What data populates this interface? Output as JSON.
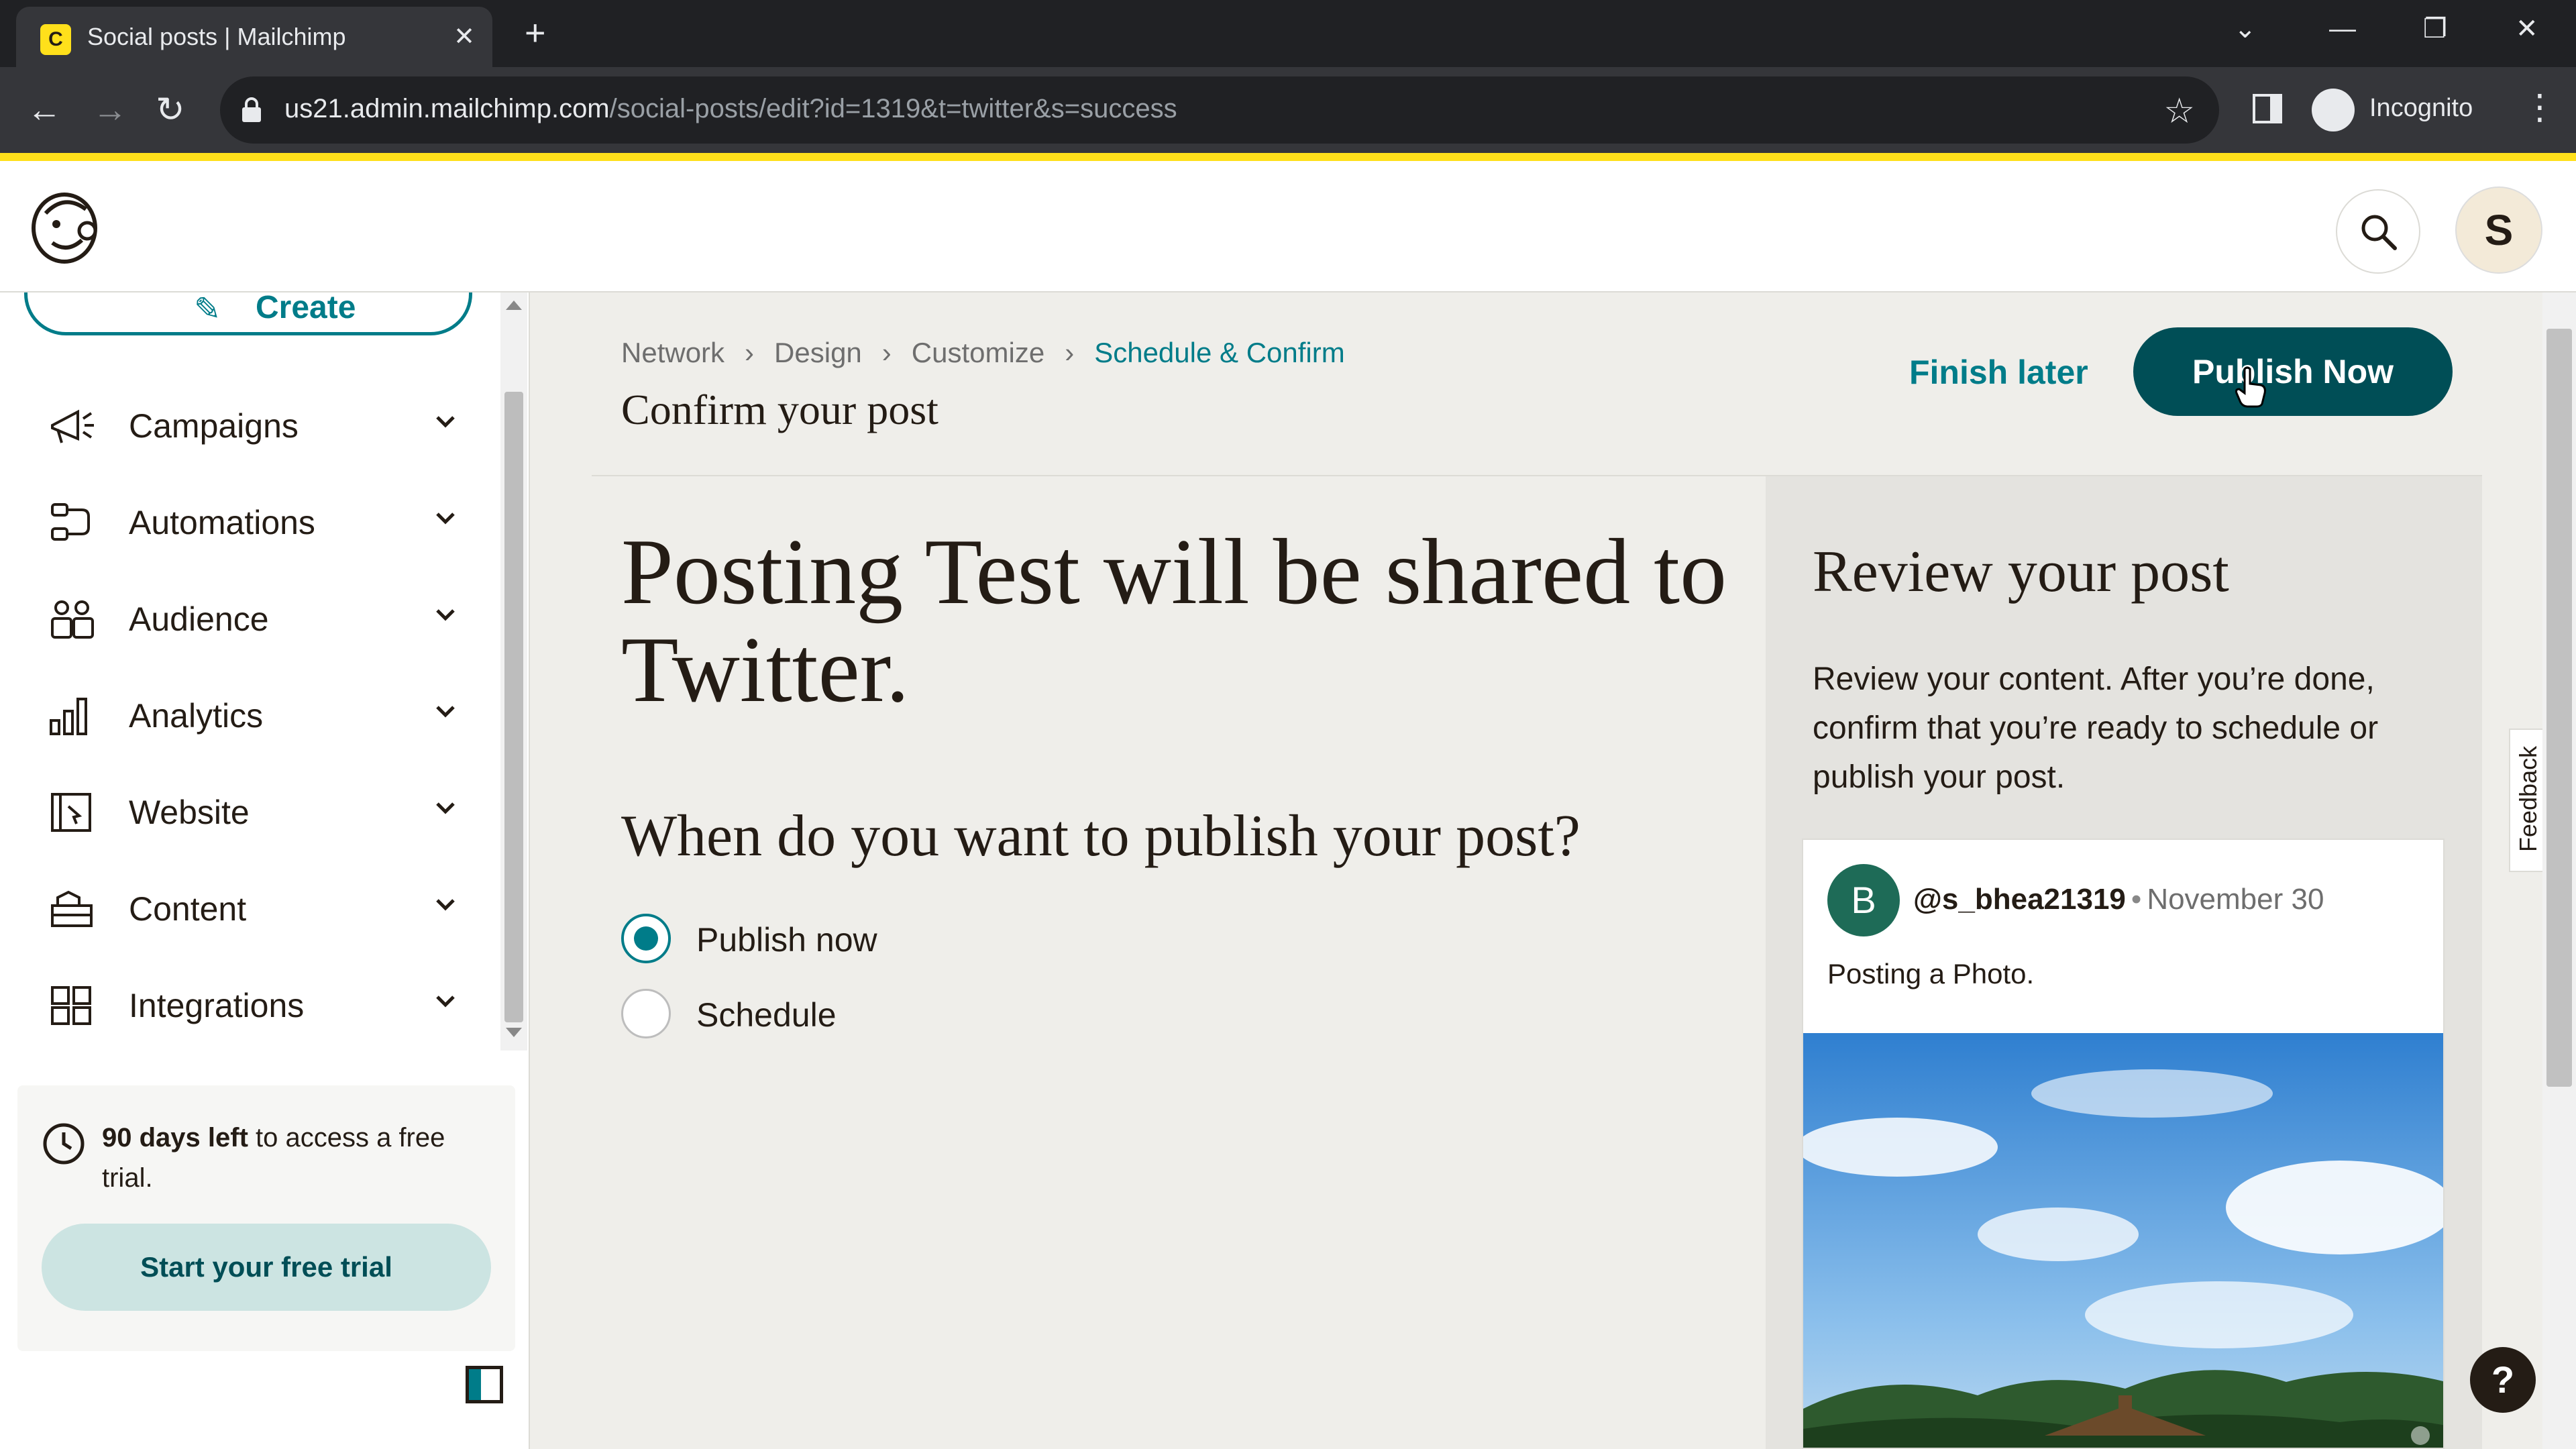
{
  "browser": {
    "tab_title": "Social posts | Mailchimp",
    "favicon_letter": "C",
    "tab_close": "✕",
    "new_tab": "+",
    "url_host": "us21.admin.mailchimp.com",
    "url_path": "/social-posts/edit?id=1319&t=twitter&s=success",
    "profile_label": "Incognito"
  },
  "header": {
    "avatar_initial": "S"
  },
  "sidebar": {
    "create_label": "Create",
    "items": [
      {
        "label": "Campaigns",
        "icon": "megaphone-icon"
      },
      {
        "label": "Automations",
        "icon": "automations-icon"
      },
      {
        "label": "Audience",
        "icon": "audience-icon"
      },
      {
        "label": "Analytics",
        "icon": "bar-chart-icon"
      },
      {
        "label": "Website",
        "icon": "website-icon"
      },
      {
        "label": "Content",
        "icon": "content-icon"
      },
      {
        "label": "Integrations",
        "icon": "grid-icon"
      }
    ],
    "trial": {
      "days_bold": "90 days left",
      "rest": " to access a free trial.",
      "button": "Start your free trial"
    }
  },
  "main": {
    "breadcrumb": [
      "Network",
      "Design",
      "Customize",
      "Schedule & Confirm"
    ],
    "page_title": "Confirm your post",
    "finish_later": "Finish later",
    "publish_now": "Publish Now",
    "headline": "Posting Test will be shared to Twitter.",
    "question": "When do you want to publish your post?",
    "options": [
      {
        "label": "Publish now",
        "checked": true
      },
      {
        "label": "Schedule",
        "checked": false
      }
    ]
  },
  "review": {
    "title": "Review your post",
    "description": "Review your content. After you’re done, confirm that you’re ready to schedule or publish your post.",
    "post": {
      "avatar_initial": "B",
      "handle": "@s_bhea21319",
      "separator": "•",
      "date": "November 30",
      "text": "Posting a Photo."
    }
  },
  "feedback_label": "Feedback",
  "help_label": "?",
  "colors": {
    "accent": "#007c89",
    "primary_button": "#004e56",
    "brand_yellow": "#ffe01b"
  }
}
